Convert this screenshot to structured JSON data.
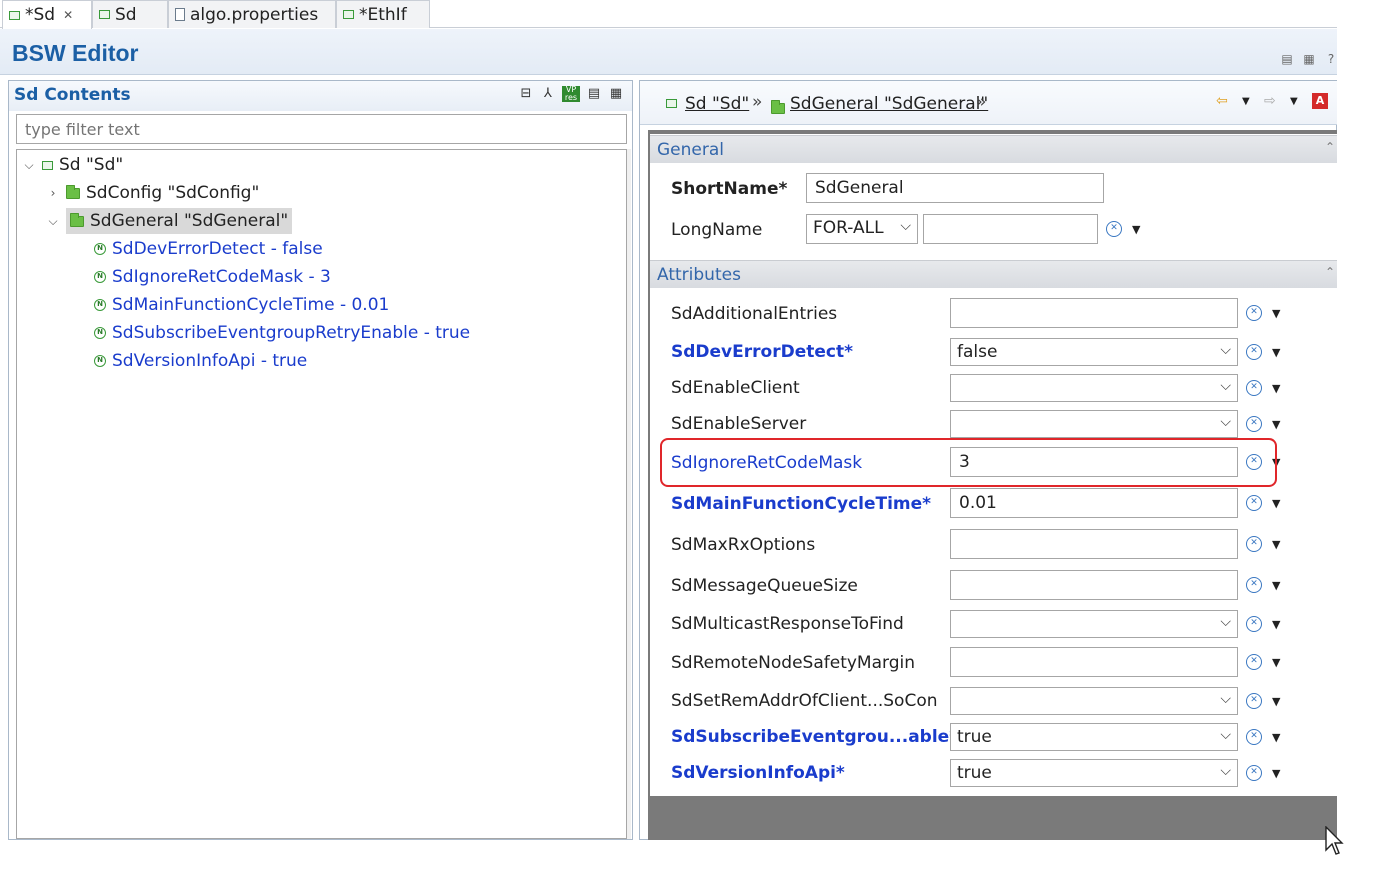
{
  "tabs": [
    {
      "label": "*Sd",
      "icon": "module-icon",
      "active": true,
      "closable": true
    },
    {
      "label": "Sd",
      "icon": "module-icon"
    },
    {
      "label": "algo.properties",
      "icon": "file-icon"
    },
    {
      "label": "*EthIf",
      "icon": "module-icon"
    }
  ],
  "editor": {
    "title": "BSW Editor"
  },
  "contents": {
    "title": "Sd Contents",
    "filter_placeholder": "type filter text",
    "tree": {
      "root": "Sd \"Sd\"",
      "config": "SdConfig \"SdConfig\"",
      "general": "SdGeneral \"SdGeneral\"",
      "params": [
        "SdDevErrorDetect - false",
        "SdIgnoreRetCodeMask - 3",
        "SdMainFunctionCycleTime - 0.01",
        "SdSubscribeEventgroupRetryEnable - true",
        "SdVersionInfoApi - true"
      ]
    }
  },
  "breadcrumb": {
    "items": [
      "Sd \"Sd\"",
      "SdGeneral \"SdGeneral\""
    ],
    "separator": "»"
  },
  "general_section": {
    "title": "General",
    "shortname_label": "ShortName*",
    "shortname_value": "SdGeneral",
    "longname_label": "LongName",
    "longname_lang": "FOR-ALL",
    "longname_value": ""
  },
  "attributes_section": {
    "title": "Attributes",
    "rows": [
      {
        "label": "SdAdditionalEntries",
        "value": ""
      },
      {
        "label": "SdDevErrorDetect*",
        "value": "false"
      },
      {
        "label": "SdEnableClient",
        "value": ""
      },
      {
        "label": "SdEnableServer",
        "value": ""
      },
      {
        "label": "SdIgnoreRetCodeMask",
        "value": "3"
      },
      {
        "label": "SdMainFunctionCycleTime*",
        "value": "0.01"
      },
      {
        "label": "SdMaxRxOptions",
        "value": ""
      },
      {
        "label": "SdMessageQueueSize",
        "value": ""
      },
      {
        "label": "SdMulticastResponseToFind",
        "value": ""
      },
      {
        "label": "SdRemoteNodeSafetyMargin",
        "value": ""
      },
      {
        "label": "SdSetRemAddrOfClient...SoCon",
        "value": ""
      },
      {
        "label": "SdSubscribeEventgrou...able*",
        "value": "true"
      },
      {
        "label": "SdVersionInfoApi*",
        "value": "true"
      }
    ]
  },
  "colors": {
    "accent": "#1b5fa5",
    "param_blue": "#1a3ccc",
    "highlight": "#e0262a"
  }
}
